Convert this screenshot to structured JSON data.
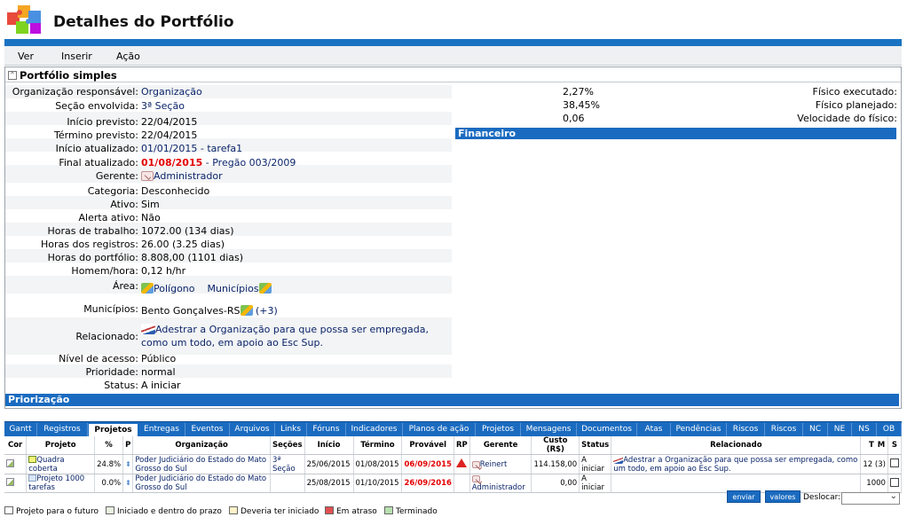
{
  "app": {
    "title": "Detalhes do Portfólio"
  },
  "menu": [
    "Ver",
    "Inserir",
    "Ação"
  ],
  "panel": {
    "title": "Portfólio simples"
  },
  "left_fields": [
    {
      "label": "Organização responsável:",
      "value": "Organização"
    },
    {
      "label": "Seção envolvida:",
      "value": "3ª Seção"
    },
    {
      "label": "Início previsto:",
      "value": "22/04/2015"
    },
    {
      "label": "Término previsto:",
      "value": "22/04/2015"
    },
    {
      "label": "Início atualizado:",
      "value": "01/01/2015 - tarefa1"
    },
    {
      "label": "Final atualizado:",
      "value_red": "01/08/2015",
      "value": " - Pregão 003/2009"
    },
    {
      "label": "Gerente:",
      "value": "Administrador"
    },
    {
      "label": "Categoria:",
      "value": "Desconhecido"
    },
    {
      "label": "Ativo:",
      "value": "Sim"
    },
    {
      "label": "Alerta ativo:",
      "value": "Não"
    },
    {
      "label": "Horas de trabalho:",
      "value": "1072.00 (134 dias)"
    },
    {
      "label": "Horas dos registros:",
      "value": "26.00 (3.25 dias)"
    },
    {
      "label": "Horas do portfólio:",
      "value": "8.808,00 (1101 dias)"
    },
    {
      "label": "Homem/hora:",
      "value": "0,12 h/hr"
    }
  ],
  "area": {
    "label": "Área:",
    "items": [
      "Polígono",
      "Municípios"
    ]
  },
  "municipios": {
    "label": "Municípios:",
    "value": "Bento Gonçalves-RS",
    "extra": "(+3)"
  },
  "relacionado": {
    "label": "Relacionado:",
    "line1": "Adestrar a Organização para que possa ser empregada,",
    "line2": "como um todo, em apoio ao Esc Sup."
  },
  "bottom_fields": [
    {
      "label": "Nível de acesso:",
      "value": "Público"
    },
    {
      "label": "Prioridade:",
      "value": "normal"
    },
    {
      "label": "Status:",
      "value": "A iniciar"
    }
  ],
  "right_fields": [
    {
      "label": "Físico executado:",
      "value": "2,27%"
    },
    {
      "label": "Físico planejado:",
      "value": "38,45%"
    },
    {
      "label": "Velocidade do físico:",
      "value": "0,06"
    }
  ],
  "financeiro": "Financeiro",
  "priorizacao": "Priorização",
  "tabs": [
    "Gantt",
    "Registros",
    "Projetos",
    "Entregas",
    "Eventos",
    "Arquivos",
    "Links",
    "Fóruns",
    "Indicadores",
    "Planos de ação",
    "Projetos",
    "Mensagens",
    "Documentos",
    "Atas",
    "Pendências",
    "Riscos",
    "Riscos",
    "NC",
    "NE",
    "NS",
    "OB"
  ],
  "active_tab": 2,
  "grid": {
    "headers": [
      "Cor",
      "Projeto",
      "%",
      "P",
      "Organização",
      "Seções",
      "Início",
      "Término",
      "Provável",
      "RP",
      "Gerente",
      "Custo (R$)",
      "Status",
      "Relacionado",
      "T",
      "M",
      "S"
    ],
    "rows": [
      {
        "projeto": "Quadra coberta",
        "pct": "24.8%",
        "org": "Poder Judiciário do Estado do Mato Grosso do Sul",
        "secoes": "3ª Seção",
        "inicio": "25/06/2015",
        "termino": "01/08/2015",
        "provavel": "06/09/2015",
        "gerente": "Reinert",
        "custo": "114.158,00",
        "status": "A iniciar",
        "relacionado": "Adestrar a Organização para que possa ser empregada, como um todo, em apoio ao Esc Sup.",
        "tm": "12 (3)"
      },
      {
        "projeto": "Projeto 1000 tarefas",
        "pct": "0.0%",
        "org": "Poder Judiciário do Estado do Mato Grosso do Sul",
        "secoes": "",
        "inicio": "25/08/2015",
        "termino": "01/10/2015",
        "provavel": "26/09/2016",
        "gerente": "Administrador",
        "custo": "0,00",
        "status": "A iniciar",
        "relacionado": "",
        "tm": "1000"
      }
    ]
  },
  "actions": {
    "enviar": "enviar",
    "valores": "valores",
    "deslocar": "Deslocar:"
  },
  "legend": [
    {
      "label": "Projeto para o futuro",
      "color": "#ffffff"
    },
    {
      "label": "Iniciado e dentro do prazo",
      "color": "#e8f0e0"
    },
    {
      "label": "Deveria ter iniciado",
      "color": "#fff2c8"
    },
    {
      "label": "Em atraso",
      "color": "#e05050"
    },
    {
      "label": "Terminado",
      "color": "#b8e0b0"
    }
  ]
}
